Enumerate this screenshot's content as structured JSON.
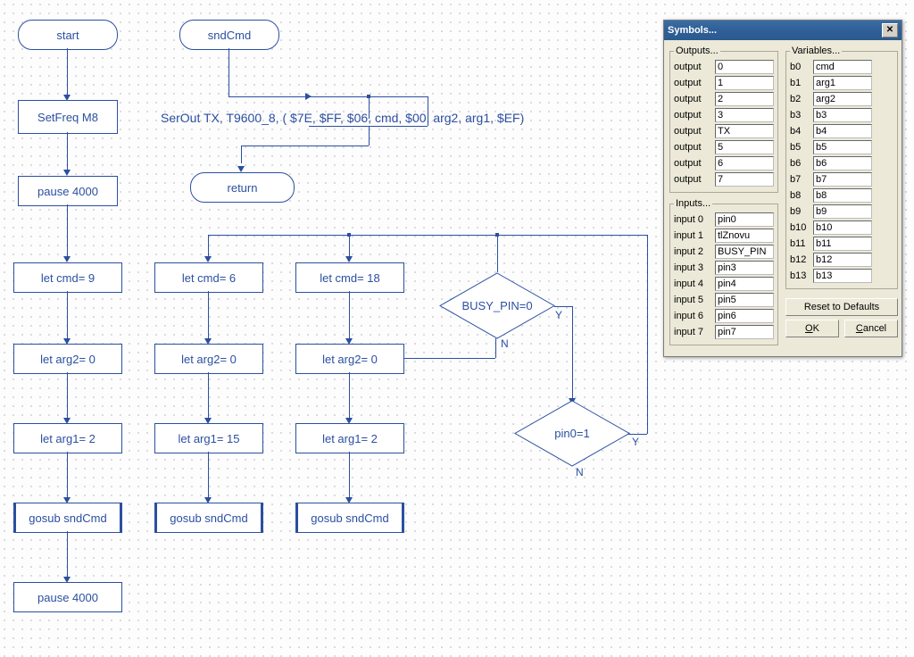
{
  "flow": {
    "start": "start",
    "sndCmd": "sndCmd",
    "setFreq": "SetFreq M8",
    "serout": "SerOut TX, T9600_8, ( $7E, $FF, $06, cmd, $00, arg2, arg1, $EF)",
    "return": "return",
    "pause1": "pause 4000",
    "pause2": "pause 4000",
    "col1": {
      "cmd": "let cmd= 9",
      "arg2": "let arg2= 0",
      "arg1": "let arg1= 2",
      "gosub": "gosub sndCmd"
    },
    "col2": {
      "cmd": "let cmd= 6",
      "arg2": "let arg2= 0",
      "arg1": "let arg1= 15",
      "gosub": "gosub sndCmd"
    },
    "col3": {
      "cmd": "let cmd= 18",
      "arg2": "let arg2= 0",
      "arg1": "let arg1= 2",
      "gosub": "gosub sndCmd"
    },
    "dec1": {
      "label": "BUSY_PIN=0",
      "y": "Y",
      "n": "N"
    },
    "dec2": {
      "label": "pin0=1",
      "y": "Y",
      "n": "N"
    }
  },
  "dialog": {
    "title": "Symbols...",
    "outputsTitle": "Outputs...",
    "inputsTitle": "Inputs...",
    "varsTitle": "Variables...",
    "outputs": [
      {
        "label": "output",
        "val": "0"
      },
      {
        "label": "output",
        "val": "1"
      },
      {
        "label": "output",
        "val": "2"
      },
      {
        "label": "output",
        "val": "3"
      },
      {
        "label": "output",
        "val": "TX"
      },
      {
        "label": "output",
        "val": "5"
      },
      {
        "label": "output",
        "val": "6"
      },
      {
        "label": "output",
        "val": "7"
      }
    ],
    "inputs": [
      {
        "label": "input 0",
        "val": "pin0"
      },
      {
        "label": "input 1",
        "val": "tlZnovu"
      },
      {
        "label": "input 2",
        "val": "BUSY_PIN"
      },
      {
        "label": "input 3",
        "val": "pin3"
      },
      {
        "label": "input 4",
        "val": "pin4"
      },
      {
        "label": "input 5",
        "val": "pin5"
      },
      {
        "label": "input 6",
        "val": "pin6"
      },
      {
        "label": "input 7",
        "val": "pin7"
      }
    ],
    "variables": [
      {
        "label": "b0",
        "val": "cmd"
      },
      {
        "label": "b1",
        "val": "arg1"
      },
      {
        "label": "b2",
        "val": "arg2"
      },
      {
        "label": "b3",
        "val": "b3"
      },
      {
        "label": "b4",
        "val": "b4"
      },
      {
        "label": "b5",
        "val": "b5"
      },
      {
        "label": "b6",
        "val": "b6"
      },
      {
        "label": "b7",
        "val": "b7"
      },
      {
        "label": "b8",
        "val": "b8"
      },
      {
        "label": "b9",
        "val": "b9"
      },
      {
        "label": "b10",
        "val": "b10"
      },
      {
        "label": "b11",
        "val": "b11"
      },
      {
        "label": "b12",
        "val": "b12"
      },
      {
        "label": "b13",
        "val": "b13"
      }
    ],
    "reset": "Reset to Defaults",
    "ok": "OK",
    "cancel": "Cancel"
  }
}
